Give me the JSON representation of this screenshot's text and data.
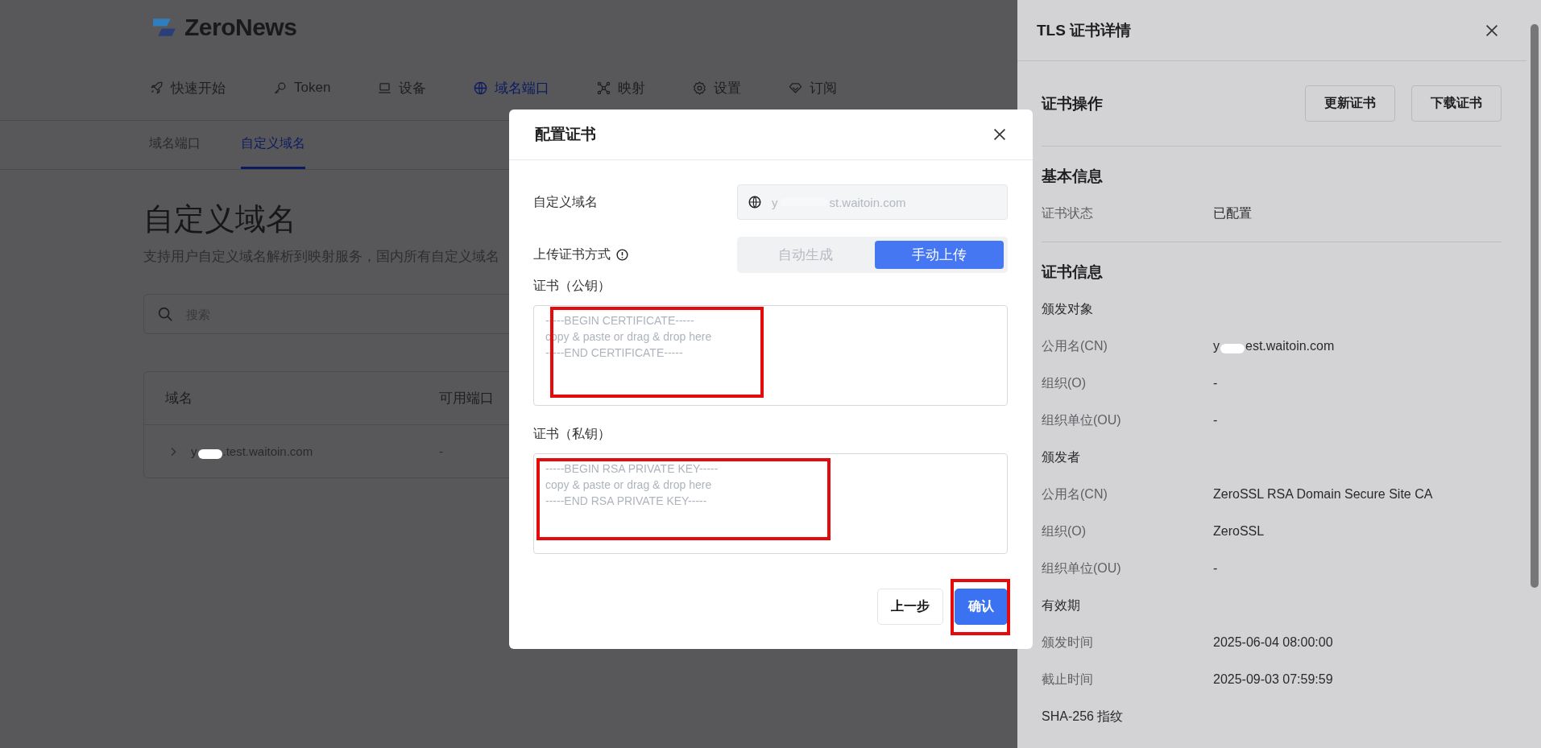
{
  "app": {
    "logo": "ZeroNews"
  },
  "nav": [
    {
      "label": "快速开始",
      "selected": false
    },
    {
      "label": "Token",
      "selected": false
    },
    {
      "label": "设备",
      "selected": false
    },
    {
      "label": "域名端口",
      "selected": true
    },
    {
      "label": "映射",
      "selected": false
    },
    {
      "label": "设置",
      "selected": false
    },
    {
      "label": "订阅",
      "selected": false
    }
  ],
  "subtabs": [
    {
      "label": "域名端口",
      "selected": false
    },
    {
      "label": "自定义域名",
      "selected": true
    }
  ],
  "page": {
    "title": "自定义域名",
    "description": "支持用户自定义域名解析到映射服务，国内所有自定义域名"
  },
  "search": {
    "placeholder": "搜索"
  },
  "table": {
    "columns": [
      "域名",
      "可用端口"
    ],
    "rows": [
      {
        "expanded": false,
        "domain": {
          "start": "y",
          "end": ".test.waitoin.com"
        },
        "ports": "-"
      }
    ]
  },
  "modal": {
    "title": "配置证书",
    "fields": [
      {
        "kind": "domain",
        "label": "自定义域名",
        "value": {
          "start": "y",
          "end": "st.waitoin.com"
        }
      },
      {
        "kind": "segmented",
        "label": "上传证书方式",
        "info": true,
        "options": [
          {
            "label": "自动生成",
            "selected": false
          },
          {
            "label": "手动上传",
            "selected": true
          }
        ]
      },
      {
        "kind": "textarea",
        "label": "证书（公钥）",
        "placeholder": "-----BEGIN CERTIFICATE-----\ncopy & paste or drag & drop here\n-----END CERTIFICATE-----",
        "highlighted": true
      },
      {
        "kind": "textarea",
        "label": "证书（私钥）",
        "placeholder": "-----BEGIN RSA PRIVATE KEY-----\ncopy & paste or drag & drop here\n-----END RSA PRIVATE KEY-----",
        "highlighted": true
      }
    ],
    "buttons": [
      {
        "label": "上一步",
        "kind": "secondary",
        "highlighted": false
      },
      {
        "label": "确认",
        "kind": "primary",
        "highlighted": true
      }
    ]
  },
  "drawer": {
    "title": "TLS 证书详情",
    "sections": [
      {
        "title": "证书操作",
        "buttons": [
          "更新证书",
          "下载证书"
        ]
      },
      {
        "title": "基本信息",
        "rows": [
          {
            "kind": "pair",
            "label": "证书状态",
            "value": "已配置"
          }
        ]
      },
      {
        "title": "证书信息",
        "rows": [
          {
            "kind": "heading",
            "label": "颁发对象"
          },
          {
            "kind": "pair",
            "label": "公用名(CN)",
            "value": {
              "start": "y",
              "end": "est.waitoin.com"
            }
          },
          {
            "kind": "pair",
            "label": "组织(O)",
            "value": "-"
          },
          {
            "kind": "pair",
            "label": "组织单位(OU)",
            "value": "-"
          },
          {
            "kind": "heading",
            "label": "颁发者"
          },
          {
            "kind": "pair",
            "label": "公用名(CN)",
            "value": "ZeroSSL RSA Domain Secure Site CA"
          },
          {
            "kind": "pair",
            "label": "组织(O)",
            "value": "ZeroSSL"
          },
          {
            "kind": "pair",
            "label": "组织单位(OU)",
            "value": "-"
          },
          {
            "kind": "heading",
            "label": "有效期"
          },
          {
            "kind": "pair",
            "label": "颁发时间",
            "value": "2025-06-04 08:00:00"
          },
          {
            "kind": "pair",
            "label": "截止时间",
            "value": "2025-09-03 07:59:59"
          },
          {
            "kind": "heading",
            "label": "SHA-256 指纹"
          }
        ]
      }
    ]
  }
}
